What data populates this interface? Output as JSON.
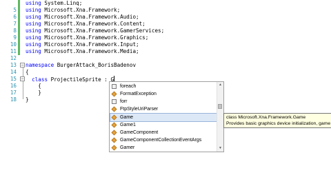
{
  "gutter": [
    "5",
    "6",
    "7",
    "8",
    "9",
    "10",
    "11",
    "12",
    "13",
    "14",
    "15",
    "16",
    "17",
    "18"
  ],
  "code": {
    "line1": {
      "kw": "using",
      "rest": " System.Linq;"
    },
    "line5": {
      "kw": "using",
      "rest": " Microsoft.Xna.Framework;"
    },
    "line6": {
      "kw": "using",
      "rest": " Microsoft.Xna.Framework.Audio;"
    },
    "line7": {
      "kw": "using",
      "rest": " Microsoft.Xna.Framework.Content;"
    },
    "line8": {
      "kw": "using",
      "rest": " Microsoft.Xna.Framework.GamerServices;"
    },
    "line9": {
      "kw": "using",
      "rest": " Microsoft.Xna.Framework.Graphics;"
    },
    "line10": {
      "kw": "using",
      "rest": " Microsoft.Xna.Framework.Input;"
    },
    "line11": {
      "kw": "using",
      "rest": " Microsoft.Xna.Framework.Media;"
    },
    "line12": {
      "kw": "namespace",
      "rest": " BurgerAttack_BorisBadenov"
    },
    "line13": "{",
    "line14": {
      "kw": "class",
      "rest": " ProjectileSprite : G"
    },
    "line15": "{",
    "line16": "}",
    "line17": "}"
  },
  "collapse_glyph": "−",
  "completion": {
    "items": [
      {
        "label": "foreach",
        "icon": "snippet-icon"
      },
      {
        "label": "FormatException",
        "icon": "class-icon"
      },
      {
        "label": "forr",
        "icon": "snippet-icon"
      },
      {
        "label": "FtpStyleUriParser",
        "icon": "class-icon"
      },
      {
        "label": "Game",
        "icon": "class-icon",
        "selected": true
      },
      {
        "label": "Game1",
        "icon": "class-icon"
      },
      {
        "label": "GameComponent",
        "icon": "class-icon"
      },
      {
        "label": "GameComponentCollectionEventArgs",
        "icon": "class-icon"
      },
      {
        "label": "Gamer",
        "icon": "class-icon"
      }
    ],
    "scroll_up": "▲",
    "scroll_down": "▼"
  },
  "tooltip": {
    "line1": "class Microsoft.Xna.Framework.Game",
    "line2": "Provides basic graphics device initialization, game"
  }
}
